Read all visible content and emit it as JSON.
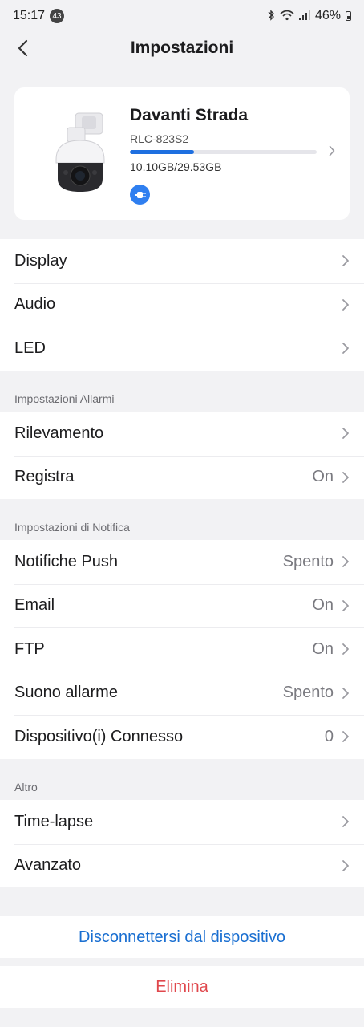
{
  "status_bar": {
    "time": "15:17",
    "notification_count": "43",
    "battery_text": "46%",
    "icons": [
      "bluetooth-icon",
      "wifi-icon",
      "signal-icon",
      "battery-icon"
    ]
  },
  "header": {
    "title": "Impostazioni",
    "back_icon": "chevron-left-icon"
  },
  "device": {
    "name": "Davanti Strada",
    "model": "RLC-823S2",
    "storage_text": "10.10GB/29.53GB",
    "storage_used_fraction": 0.342,
    "connection_icon": "plug-icon",
    "accent_color": "#1e6fe0"
  },
  "general": {
    "items": [
      {
        "label": "Display",
        "value": ""
      },
      {
        "label": "Audio",
        "value": ""
      },
      {
        "label": "LED",
        "value": ""
      }
    ]
  },
  "alarm": {
    "title": "Impostazioni Allarmi",
    "items": [
      {
        "label": "Rilevamento",
        "value": ""
      },
      {
        "label": "Registra",
        "value": "On"
      }
    ]
  },
  "notification": {
    "title": "Impostazioni di Notifica",
    "items": [
      {
        "label": "Notifiche Push",
        "value": "Spento"
      },
      {
        "label": "Email",
        "value": "On"
      },
      {
        "label": "FTP",
        "value": "On"
      },
      {
        "label": "Suono allarme",
        "value": "Spento"
      },
      {
        "label": "Dispositivo(i) Connesso",
        "value": "0"
      }
    ]
  },
  "other": {
    "title": "Altro",
    "items": [
      {
        "label": "Time-lapse",
        "value": ""
      },
      {
        "label": "Avanzato",
        "value": ""
      }
    ]
  },
  "actions": {
    "disconnect_label": "Disconnettersi dal dispositivo",
    "delete_label": "Elimina",
    "disconnect_color": "#1a6fd1",
    "delete_color": "#e0474c"
  }
}
